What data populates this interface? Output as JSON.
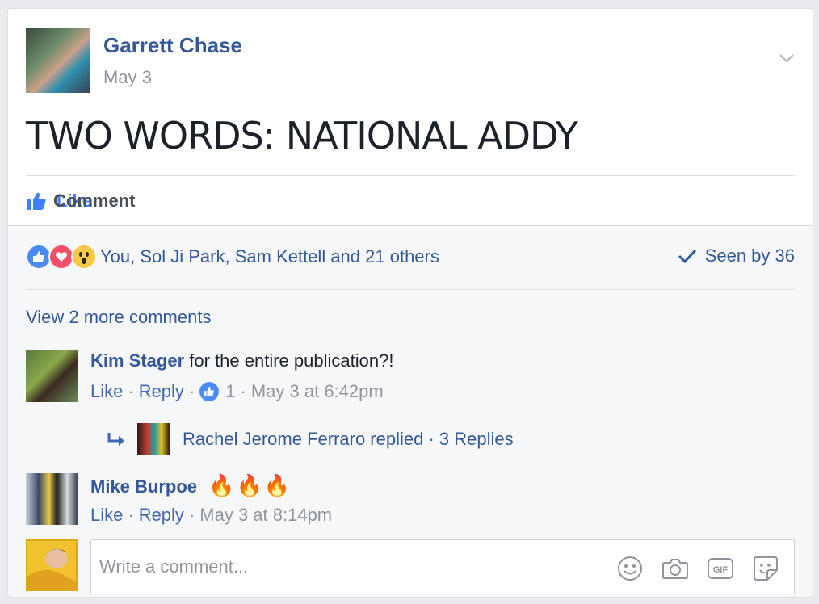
{
  "post": {
    "author": "Garrett Chase",
    "date": "May 3",
    "text": "TWO WORDS: NATIONAL ADDY"
  },
  "actions": {
    "like_label": "Like",
    "comment_label": "Comment"
  },
  "reactions": {
    "summary": "You, Sol Ji Park, Sam Kettell and 21 others",
    "seen_label": "Seen by 36",
    "icons": [
      "like-icon",
      "love-icon",
      "wow-icon"
    ]
  },
  "comments": {
    "view_more_label": "View 2 more comments",
    "items": [
      {
        "author": "Kim Stager",
        "text": "for the entire publication?!",
        "like_label": "Like",
        "reply_label": "Reply",
        "like_count": "1",
        "timestamp": "May 3 at 6:42pm",
        "replies_text": "Rachel Jerome Ferraro replied · 3 Replies"
      },
      {
        "author": "Mike Burpoe",
        "text": "🔥🔥🔥",
        "like_label": "Like",
        "reply_label": "Reply",
        "timestamp": "May 3 at 8:14pm"
      }
    ]
  },
  "composer": {
    "placeholder": "Write a comment...",
    "tools": [
      "smiley-icon",
      "camera-icon",
      "gif-icon",
      "sticker-icon"
    ]
  },
  "colors": {
    "link": "#365899",
    "like_active": "#4080ff",
    "meta": "#90949c",
    "background": "#f6f7f9"
  }
}
